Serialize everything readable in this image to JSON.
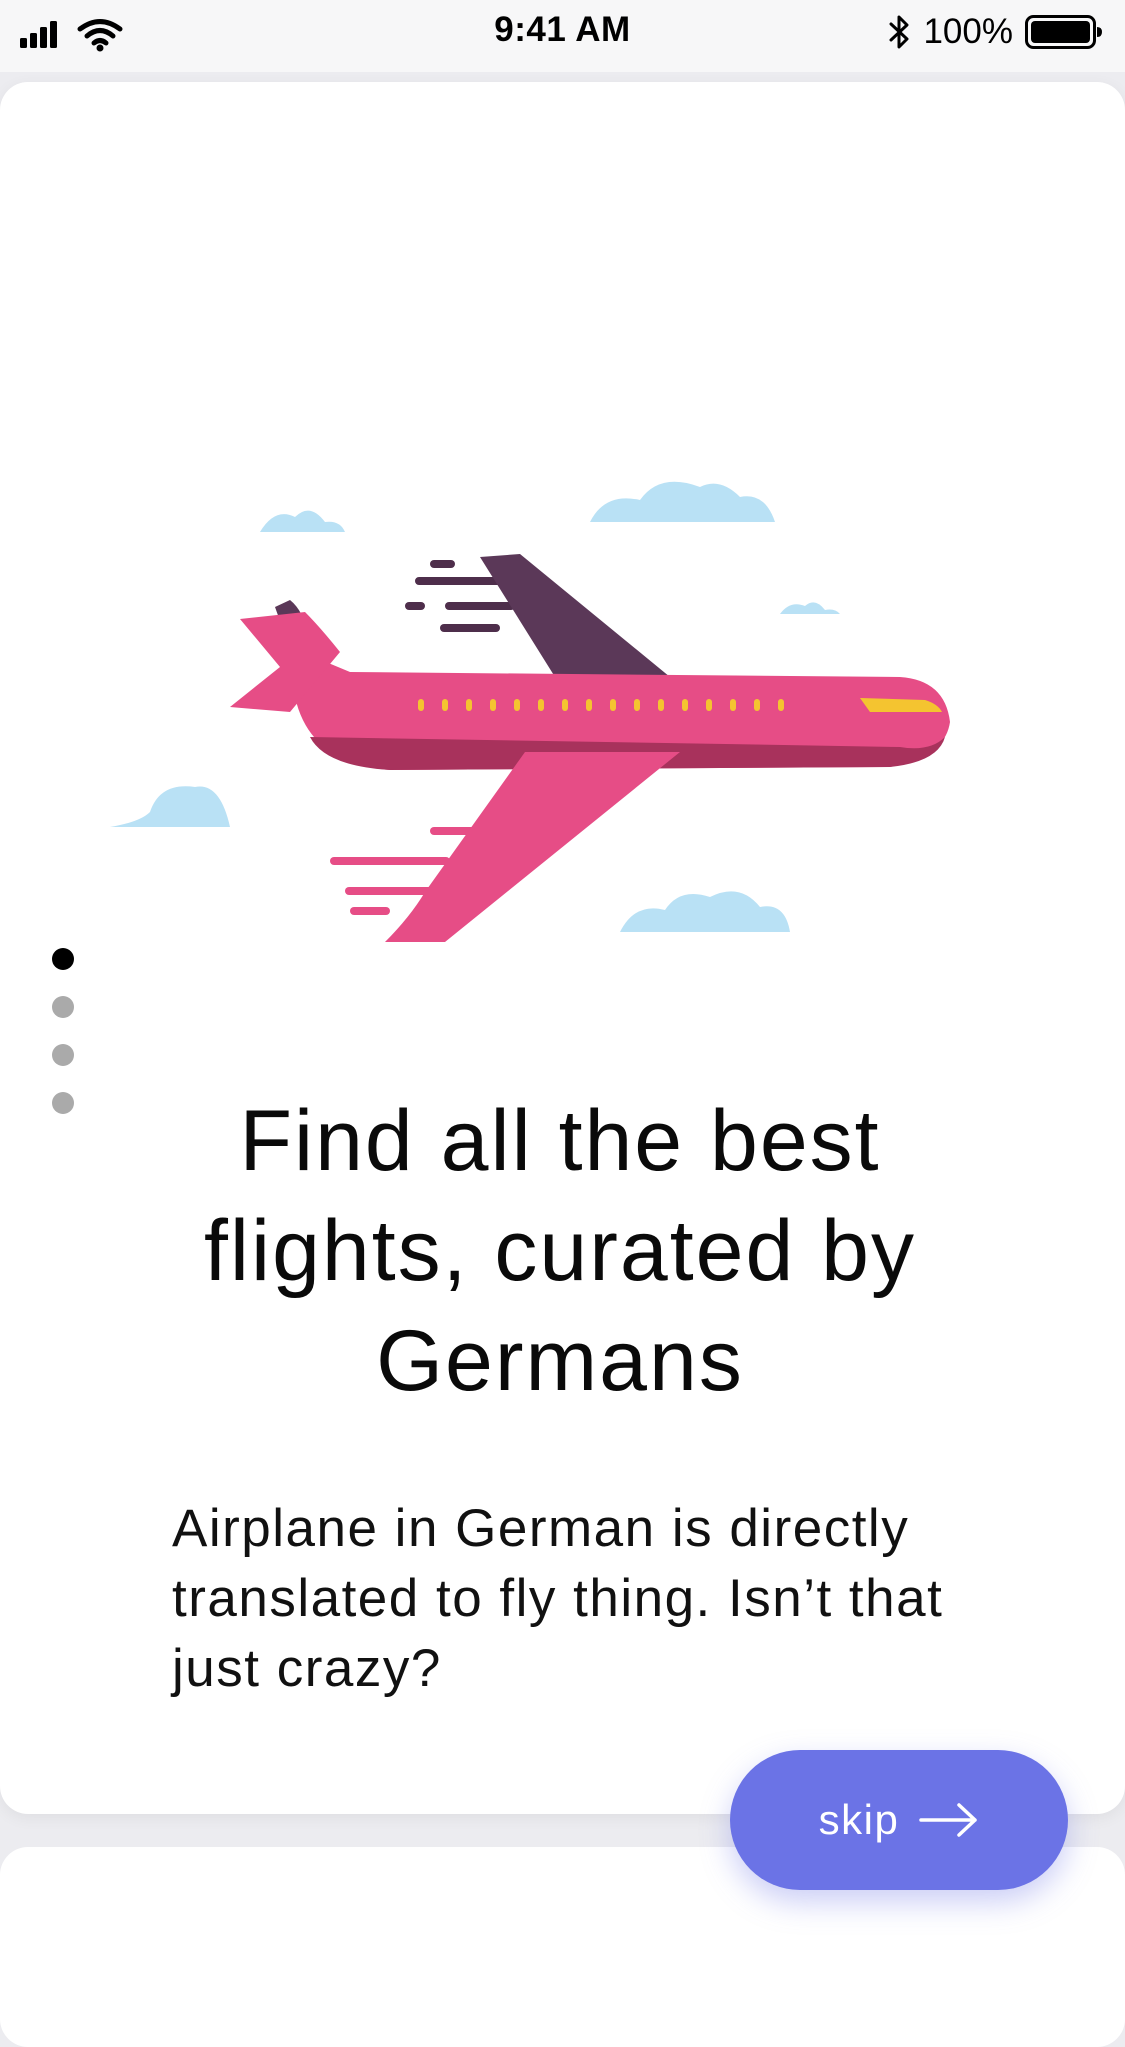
{
  "status_bar": {
    "time": "9:41 AM",
    "battery": "100%",
    "icons": [
      "signal-icon",
      "wifi-icon",
      "bluetooth-icon",
      "battery-icon"
    ]
  },
  "onboarding": {
    "title": "Find all the best flights, curated by Germans",
    "body": "Airplane in German is directly translated to fly thing. Isn’t that just crazy?",
    "page_count": 4,
    "active_page": 1,
    "skip_label": "skip"
  },
  "colors": {
    "accent": "#6b73e6",
    "plane_body": "#e64d86",
    "plane_dark": "#a8325c",
    "plane_wing_dark": "#5b3858",
    "window_yellow": "#f4c430",
    "cloud": "#b9e1f5"
  }
}
